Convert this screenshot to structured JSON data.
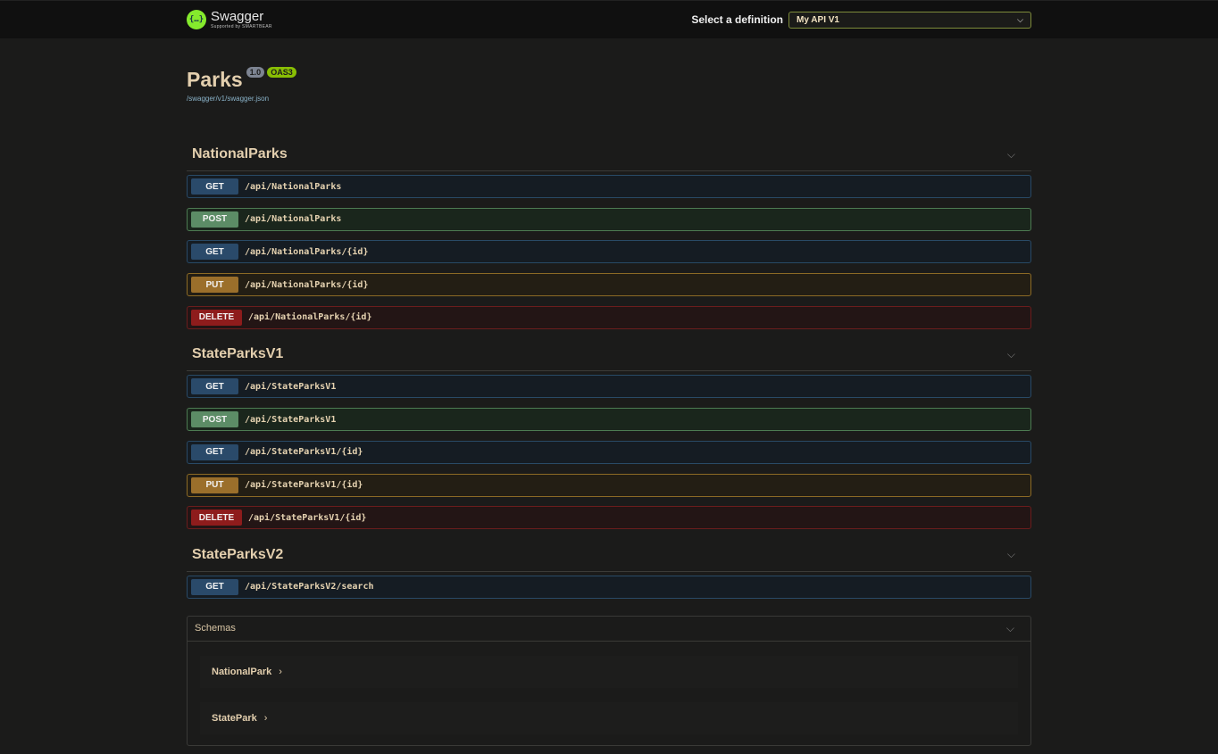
{
  "topbar": {
    "logo_text": "Swagger",
    "logo_sub": "Supported by SMARTBEAR",
    "logo_mark": "{…}",
    "definition_label": "Select a definition",
    "definition_value": "My API V1"
  },
  "info": {
    "title": "Parks",
    "version": "1.0",
    "oas": "OAS3",
    "spec_url": "/swagger/v1/swagger.json"
  },
  "tags": [
    {
      "name": "NationalParks",
      "ops": [
        {
          "method": "GET",
          "path": "/api/NationalParks"
        },
        {
          "method": "POST",
          "path": "/api/NationalParks"
        },
        {
          "method": "GET",
          "path": "/api/NationalParks/{id}"
        },
        {
          "method": "PUT",
          "path": "/api/NationalParks/{id}"
        },
        {
          "method": "DELETE",
          "path": "/api/NationalParks/{id}"
        }
      ]
    },
    {
      "name": "StateParksV1",
      "ops": [
        {
          "method": "GET",
          "path": "/api/StateParksV1"
        },
        {
          "method": "POST",
          "path": "/api/StateParksV1"
        },
        {
          "method": "GET",
          "path": "/api/StateParksV1/{id}"
        },
        {
          "method": "PUT",
          "path": "/api/StateParksV1/{id}"
        },
        {
          "method": "DELETE",
          "path": "/api/StateParksV1/{id}"
        }
      ]
    },
    {
      "name": "StateParksV2",
      "ops": [
        {
          "method": "GET",
          "path": "/api/StateParksV2/search"
        }
      ]
    }
  ],
  "schemas": {
    "title": "Schemas",
    "items": [
      "NationalPark",
      "StatePark"
    ]
  },
  "colors": {
    "get": "#2a4a6a",
    "post": "#5c8c66",
    "put": "#9b6f2b",
    "delete": "#8e1c1c"
  }
}
